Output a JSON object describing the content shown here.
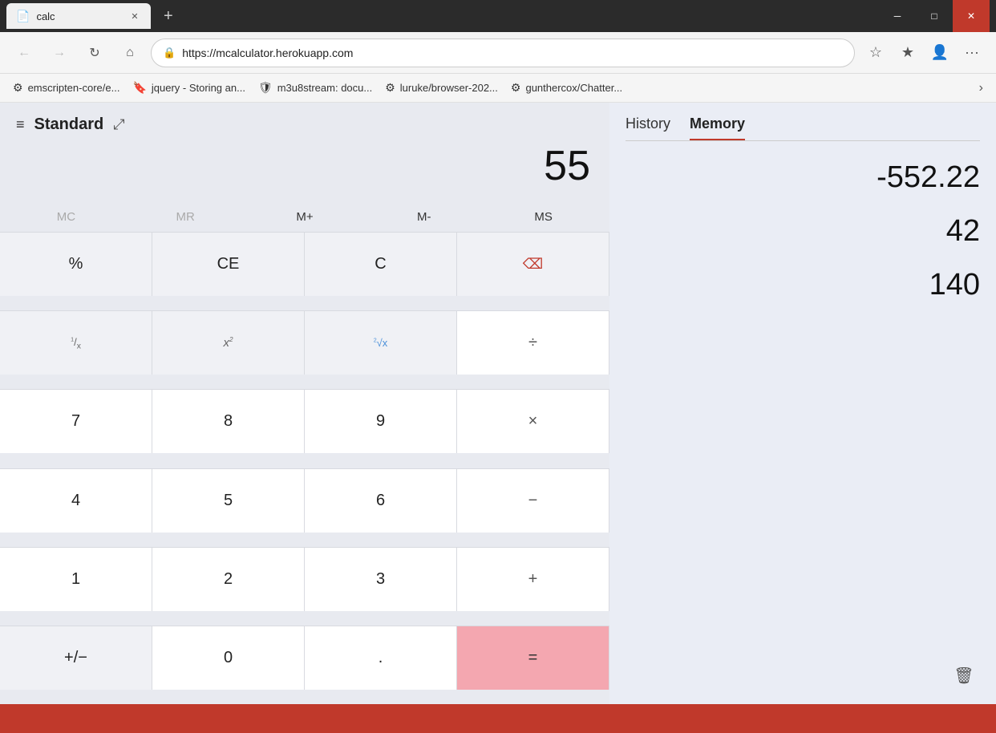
{
  "browser": {
    "tab": {
      "icon": "📄",
      "title": "calc",
      "close": "✕"
    },
    "tab_new": "+",
    "nav": {
      "back": "←",
      "forward": "→",
      "refresh": "↻",
      "home": "⌂",
      "url": "https://mcalculator.herokuapp.com",
      "lock_icon": "🔒"
    },
    "nav_actions": {
      "favorites": "☆",
      "collections": "★",
      "profile": "👤",
      "more": "···"
    },
    "bookmarks": [
      {
        "icon": "⚙",
        "label": "emscripten-core/e..."
      },
      {
        "icon": "🔖",
        "label": "jquery - Storing an..."
      },
      {
        "icon": "🛡",
        "label": "m3u8stream: docu..."
      },
      {
        "icon": "⚙",
        "label": "luruke/browser-202..."
      },
      {
        "icon": "⚙",
        "label": "gunthercox/Chatter..."
      }
    ],
    "bookmarks_more": "›"
  },
  "calculator": {
    "title": "Standard",
    "expand_icon": "⤢",
    "hamburger": "≡",
    "display": {
      "value": "55"
    },
    "memory_buttons": [
      {
        "label": "MC",
        "id": "mc",
        "disabled": true
      },
      {
        "label": "MR",
        "id": "mr",
        "disabled": true
      },
      {
        "label": "M+",
        "id": "mplus",
        "disabled": false
      },
      {
        "label": "M-",
        "id": "mminus",
        "disabled": false
      },
      {
        "label": "MS",
        "id": "ms",
        "disabled": false
      }
    ],
    "buttons": [
      {
        "label": "%",
        "type": "light"
      },
      {
        "label": "CE",
        "type": "light"
      },
      {
        "label": "C",
        "type": "light"
      },
      {
        "label": "⌫",
        "type": "light",
        "color": "red"
      },
      {
        "label": "1/x",
        "type": "special"
      },
      {
        "label": "x²",
        "type": "special"
      },
      {
        "label": "²√x",
        "type": "special"
      },
      {
        "label": "÷",
        "type": "operator"
      },
      {
        "label": "7",
        "type": "number"
      },
      {
        "label": "8",
        "type": "number"
      },
      {
        "label": "9",
        "type": "number"
      },
      {
        "label": "×",
        "type": "operator"
      },
      {
        "label": "4",
        "type": "number"
      },
      {
        "label": "5",
        "type": "number"
      },
      {
        "label": "6",
        "type": "number"
      },
      {
        "label": "−",
        "type": "operator"
      },
      {
        "label": "1",
        "type": "number"
      },
      {
        "label": "2",
        "type": "number"
      },
      {
        "label": "3",
        "type": "number"
      },
      {
        "label": "+",
        "type": "operator"
      },
      {
        "label": "+/−",
        "type": "light"
      },
      {
        "label": "0",
        "type": "number"
      },
      {
        "label": ".",
        "type": "number"
      },
      {
        "label": "=",
        "type": "equals"
      }
    ]
  },
  "right_panel": {
    "tabs": [
      {
        "label": "History",
        "active": false
      },
      {
        "label": "Memory",
        "active": true
      }
    ],
    "memory_values": [
      "-552.22",
      "42",
      "140"
    ],
    "trash_icon": "🗑"
  }
}
